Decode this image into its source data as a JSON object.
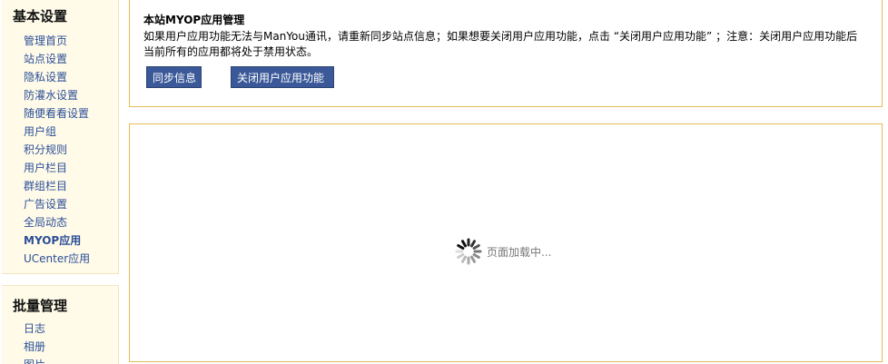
{
  "sidebar": {
    "basic": {
      "title": "基本设置",
      "items": [
        {
          "label": "管理首页"
        },
        {
          "label": "站点设置"
        },
        {
          "label": "隐私设置"
        },
        {
          "label": "防灌水设置"
        },
        {
          "label": "随便看看设置"
        },
        {
          "label": "用户组"
        },
        {
          "label": "积分规则"
        },
        {
          "label": "用户栏目"
        },
        {
          "label": "群组栏目"
        },
        {
          "label": "广告设置"
        },
        {
          "label": "全局动态"
        },
        {
          "label": "MYOP应用",
          "active": true
        },
        {
          "label": "UCenter应用"
        }
      ]
    },
    "batch": {
      "title": "批量管理",
      "items": [
        {
          "label": "日志"
        },
        {
          "label": "相册"
        },
        {
          "label": "图片"
        }
      ]
    }
  },
  "notice": {
    "title": "本站MYOP应用管理",
    "line1": "如果用户应用功能无法与ManYou通讯，请重新同步站点信息；如果想要关闭用户应用功能，点击 “关闭用户应用功能” ；注意：关闭用户应用功能后",
    "line2": "当前所有的应用都将处于禁用状态。",
    "sync_button": "同步信息",
    "close_button": "关闭用户应用功能"
  },
  "content": {
    "loading_text": "页面加载中...",
    "loading_icon": "spinner-icon"
  },
  "colors": {
    "sidebar_bg": "#fffbe8",
    "link": "#2b4e99",
    "button_bg": "#3b5998",
    "frame_border": "#e3bc55"
  }
}
